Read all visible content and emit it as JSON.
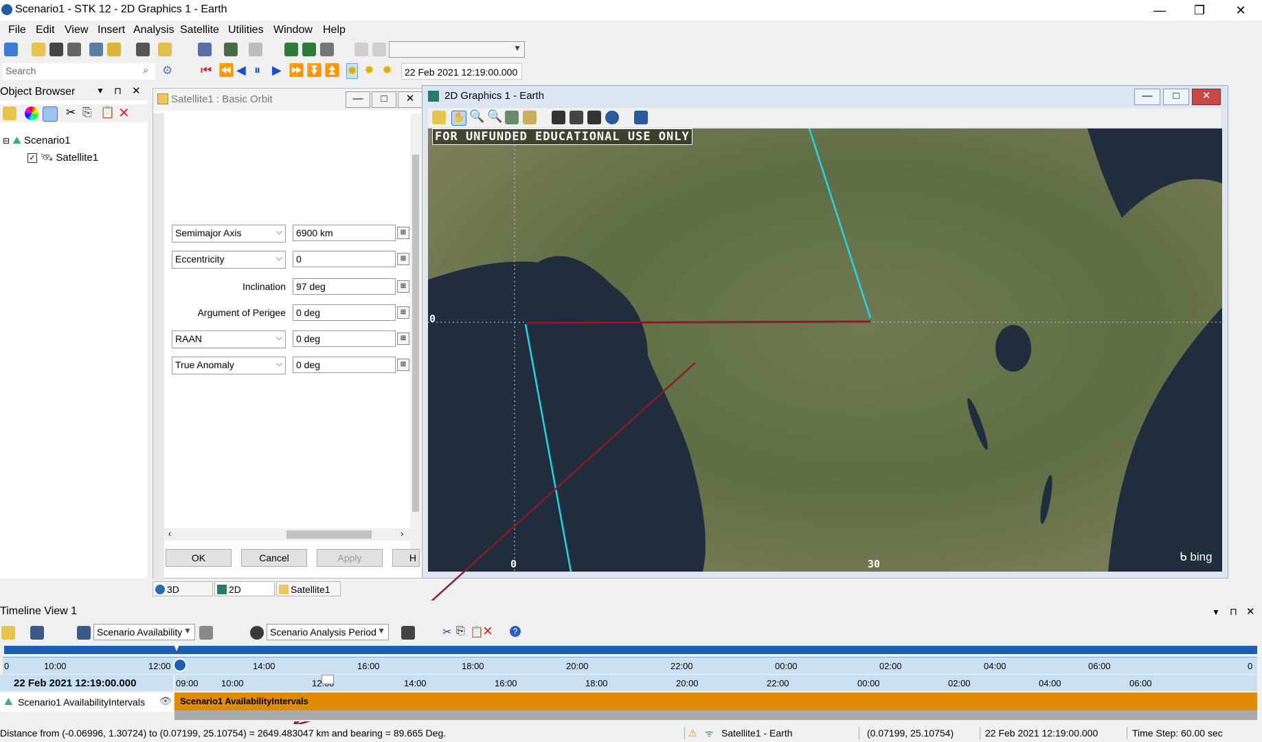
{
  "window": {
    "title": "Scenario1 - STK 12 - 2D Graphics 1 - Earth",
    "controls": [
      "—",
      "❐",
      "✕"
    ]
  },
  "menu": [
    "File",
    "Edit",
    "View",
    "Insert",
    "Analysis",
    "Satellite",
    "Utilities",
    "Window",
    "Help"
  ],
  "toolbar": {
    "search_placeholder": "Search",
    "current_time": "22 Feb 2021 12:19:00.000"
  },
  "object_browser": {
    "title": "Object Browser",
    "tree": [
      {
        "label": "Scenario1",
        "expander": "⊟"
      },
      {
        "label": "Satellite1",
        "checked": true
      }
    ]
  },
  "orbit_panel": {
    "title": "Satellite1 : Basic Orbit",
    "fields": [
      {
        "label": "Semimajor Axis",
        "type": "combo",
        "value": "6900 km"
      },
      {
        "label": "Eccentricity",
        "type": "combo",
        "value": "0"
      },
      {
        "label": "Inclination",
        "type": "label",
        "value": "97 deg"
      },
      {
        "label": "Argument of Perigee",
        "type": "label",
        "value": "0 deg"
      },
      {
        "label": "RAAN",
        "type": "combo",
        "value": "0 deg"
      },
      {
        "label": "True Anomaly",
        "type": "combo",
        "value": "0 deg"
      }
    ],
    "buttons": {
      "ok": "OK",
      "cancel": "Cancel",
      "apply": "Apply",
      "help": "H"
    }
  },
  "graphics2d": {
    "title": "2D Graphics 1 - Earth",
    "watermark": "FOR UNFUNDED EDUCATIONAL USE ONLY",
    "lat_label": "0",
    "lon_labels": [
      "0",
      "30"
    ],
    "bing_label": "bing",
    "colors": {
      "ground_track": "#26d6e8",
      "measure_line": "#8b1a2b"
    }
  },
  "window_tabs": [
    "3D Graph...",
    "2D Graph...",
    "Satellite1 ..."
  ],
  "timeline": {
    "title": "Timeline View 1",
    "availability_combo": "Scenario Availability",
    "period_combo": "Scenario Analysis Period",
    "overview_ticks": [
      "10:00",
      "12:00",
      "14:00",
      "16:00",
      "18:00",
      "20:00",
      "22:00",
      "00:00",
      "02:00",
      "04:00",
      "06:00",
      "0",
      "0"
    ],
    "current_time": "22 Feb 2021 12:19:00.000",
    "detail_ticks": [
      "09:00",
      "10:00",
      "12:00",
      "14:00",
      "16:00",
      "18:00",
      "20:00",
      "22:00",
      "00:00",
      "02:00",
      "04:00",
      "06:00"
    ],
    "row_label": "Scenario1 AvailabilityIntervals",
    "bar_label": "Scenario1 AvailabilityIntervals",
    "colors": {
      "bar": "#e08a00",
      "overview": "#1a5fb4"
    }
  },
  "statusbar": {
    "message": "Distance from (-0.06996, 1.30724) to (0.07199, 25.10754) = 2649.483047 km and bearing = 89.665 Deg.",
    "object": "Satellite1 - Earth",
    "cursor": "(0.07199, 25.10754)",
    "time": "22 Feb 2021 12:19:00.000",
    "timestep": "Time Step: 60.00 sec"
  }
}
